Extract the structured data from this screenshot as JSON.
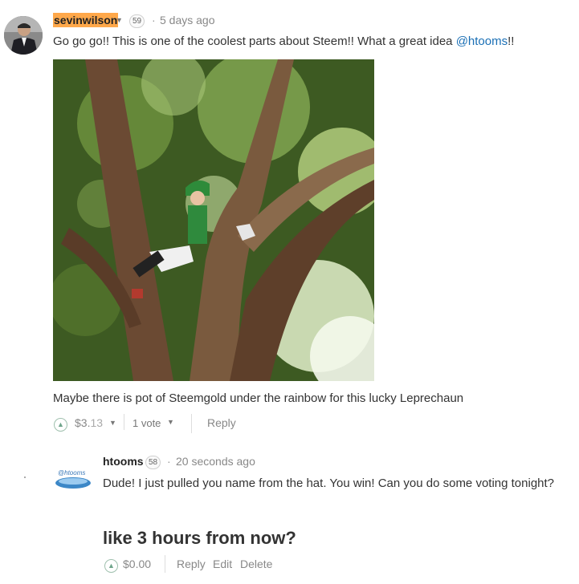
{
  "comment1": {
    "author": "sevinwilson",
    "reputation": "59",
    "separator": "·",
    "timestamp": "5 days ago",
    "text_before_mention": "Go go go!! This is one of the coolest parts about Steem!! What a great idea ",
    "mention": "@htooms",
    "text_after_mention": "!!",
    "caption": "Maybe there is pot of Steemgold under the rainbow for this lucky Leprechaun",
    "payout_main": "$3.",
    "payout_cents": "13",
    "votes": "1 vote",
    "reply_label": "Reply"
  },
  "comment2": {
    "avatar_label": "@htooms",
    "author": "htooms",
    "reputation": "58",
    "separator": "·",
    "timestamp": "20 seconds ago",
    "text": "Dude! I just pulled you name from the hat. You win! Can you do some voting tonight?",
    "big_text": "like 3 hours from now?",
    "payout_main": "$0.",
    "payout_cents": "00",
    "reply_label": "Reply",
    "edit_label": "Edit",
    "delete_label": "Delete"
  },
  "icons": {
    "upvote": "chevron-up-circle-icon",
    "dropdown": "caret-down-icon"
  },
  "colors": {
    "author_highlight": "#ffa84a",
    "mention": "#1a6fb5",
    "upvote": "#6fa58b"
  }
}
